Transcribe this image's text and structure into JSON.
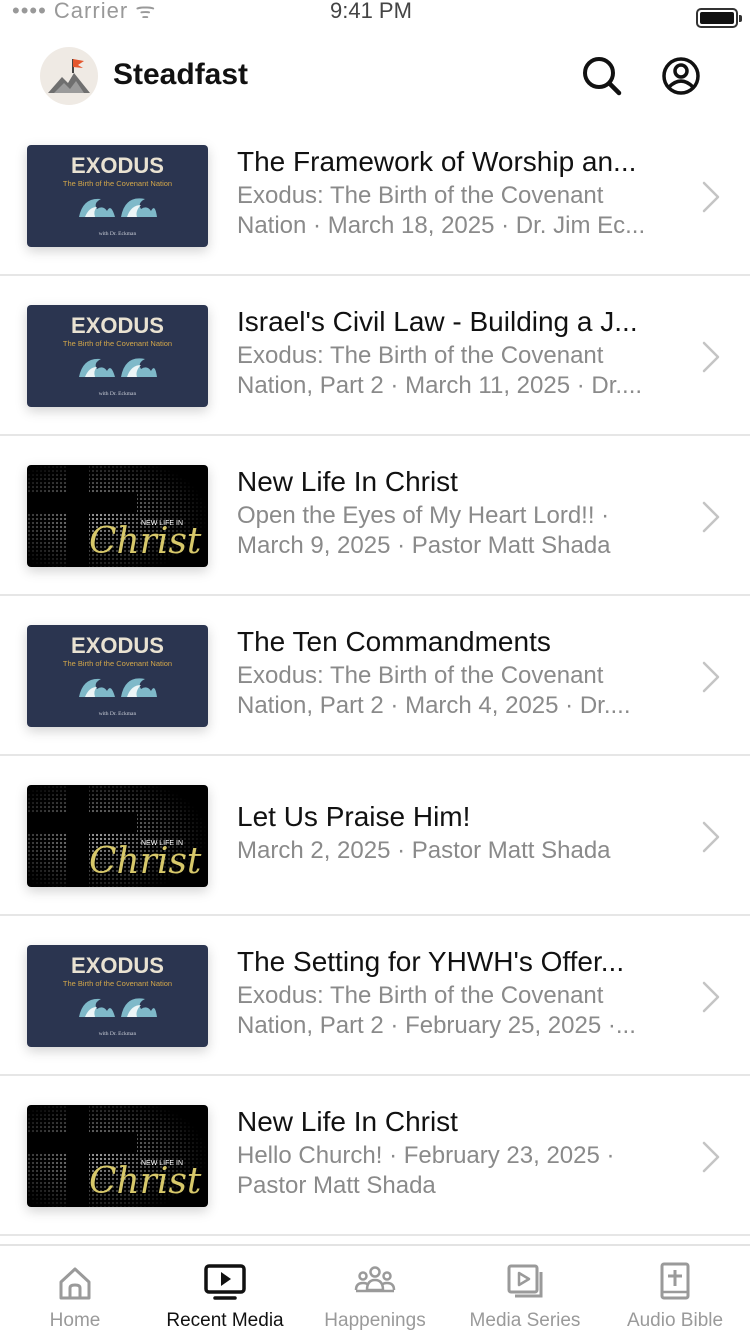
{
  "status_bar": {
    "carrier": "•••• Carrier ᯤ",
    "time": "9:41 PM"
  },
  "header": {
    "title": "Steadfast"
  },
  "thumbnails": {
    "exodus": {
      "title": "EXODUS",
      "subtitle": "The Birth of the Covenant Nation",
      "byline": "with Dr. Eckman"
    },
    "newlife": {
      "small": "NEW LIFE IN",
      "script": "Christ"
    }
  },
  "media_items": [
    {
      "thumb": "exodus",
      "title": "The Framework of Worship an...",
      "sub1": "Exodus: The Birth of the Covenant",
      "sub2": "Nation · March 18, 2025 · Dr. Jim Ec..."
    },
    {
      "thumb": "exodus",
      "title": "Israel's Civil Law - Building a J...",
      "sub1": "Exodus: The Birth of the Covenant",
      "sub2": "Nation, Part 2 · March 11, 2025 · Dr...."
    },
    {
      "thumb": "newlife",
      "title": "New Life In Christ",
      "sub1": "Open the Eyes of My Heart Lord!! ·",
      "sub2": "March 9, 2025 · Pastor Matt Shada"
    },
    {
      "thumb": "exodus",
      "title": "The Ten Commandments",
      "sub1": "Exodus: The Birth of the Covenant",
      "sub2": "Nation, Part 2 · March 4, 2025 · Dr...."
    },
    {
      "thumb": "newlife",
      "title": "Let Us Praise Him!",
      "sub1": "March 2, 2025 · Pastor Matt Shada",
      "sub2": ""
    },
    {
      "thumb": "exodus",
      "title": "The Setting for YHWH's Offer...",
      "sub1": "Exodus: The Birth of the Covenant",
      "sub2": "Nation, Part 2 · February 25, 2025 ·..."
    },
    {
      "thumb": "newlife",
      "title": "New Life In Christ",
      "sub1": "Hello Church! · February 23, 2025 ·",
      "sub2": "Pastor Matt Shada"
    }
  ],
  "tabs": [
    {
      "label": "Home",
      "icon": "home-icon",
      "active": false
    },
    {
      "label": "Recent Media",
      "icon": "tv-play-icon",
      "active": true
    },
    {
      "label": "Happenings",
      "icon": "people-icon",
      "active": false
    },
    {
      "label": "Media Series",
      "icon": "media-stack-icon",
      "active": false
    },
    {
      "label": "Audio Bible",
      "icon": "bible-icon",
      "active": false
    }
  ],
  "colors": {
    "exodus_bg": "#2b3550",
    "exodus_title": "#e9e2d2",
    "exodus_subtitle": "#d2a64a",
    "wave": "#7fb9c9",
    "christ_gold": "#d7c86a",
    "inactive": "#9a9a9a",
    "active": "#111111",
    "divider": "#e6e6e6"
  }
}
